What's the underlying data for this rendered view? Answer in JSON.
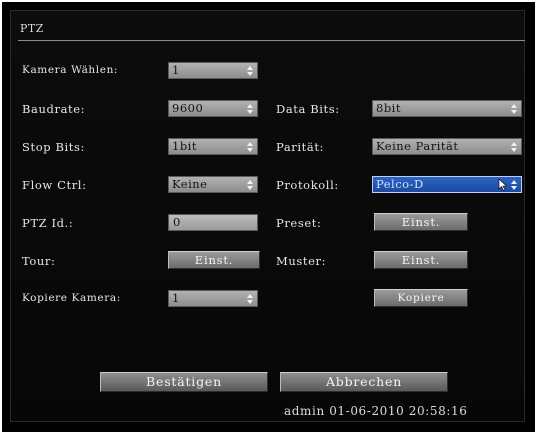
{
  "panel": {
    "title": "PTZ"
  },
  "fields": {
    "camera_label": "Kamera Wählen:",
    "camera_value": "1",
    "baudrate_label": "Baudrate:",
    "baudrate_value": "9600",
    "databits_label": "Data Bits:",
    "databits_value": "8bit",
    "stopbits_label": "Stop Bits:",
    "stopbits_value": "1bit",
    "parity_label": "Parität:",
    "parity_value": "Keine Parität",
    "flowctrl_label": "Flow Ctrl:",
    "flowctrl_value": "Keine",
    "protocol_label": "Protokoll:",
    "protocol_value": "Pelco-D",
    "ptzid_label": "PTZ Id.:",
    "ptzid_value": "0",
    "preset_label": "Preset:",
    "preset_button": "Einst.",
    "tour_label": "Tour:",
    "tour_button": "Einst.",
    "muster_label": "Muster:",
    "muster_button": "Einst.",
    "copycam_label": "Kopiere Kamera:",
    "copycam_value": "1",
    "copy_button": "Kopiere"
  },
  "footer": {
    "confirm_button": "Bestätigen",
    "cancel_button": "Abbrechen",
    "status": "admin 01-06-2010 20:58:16"
  }
}
